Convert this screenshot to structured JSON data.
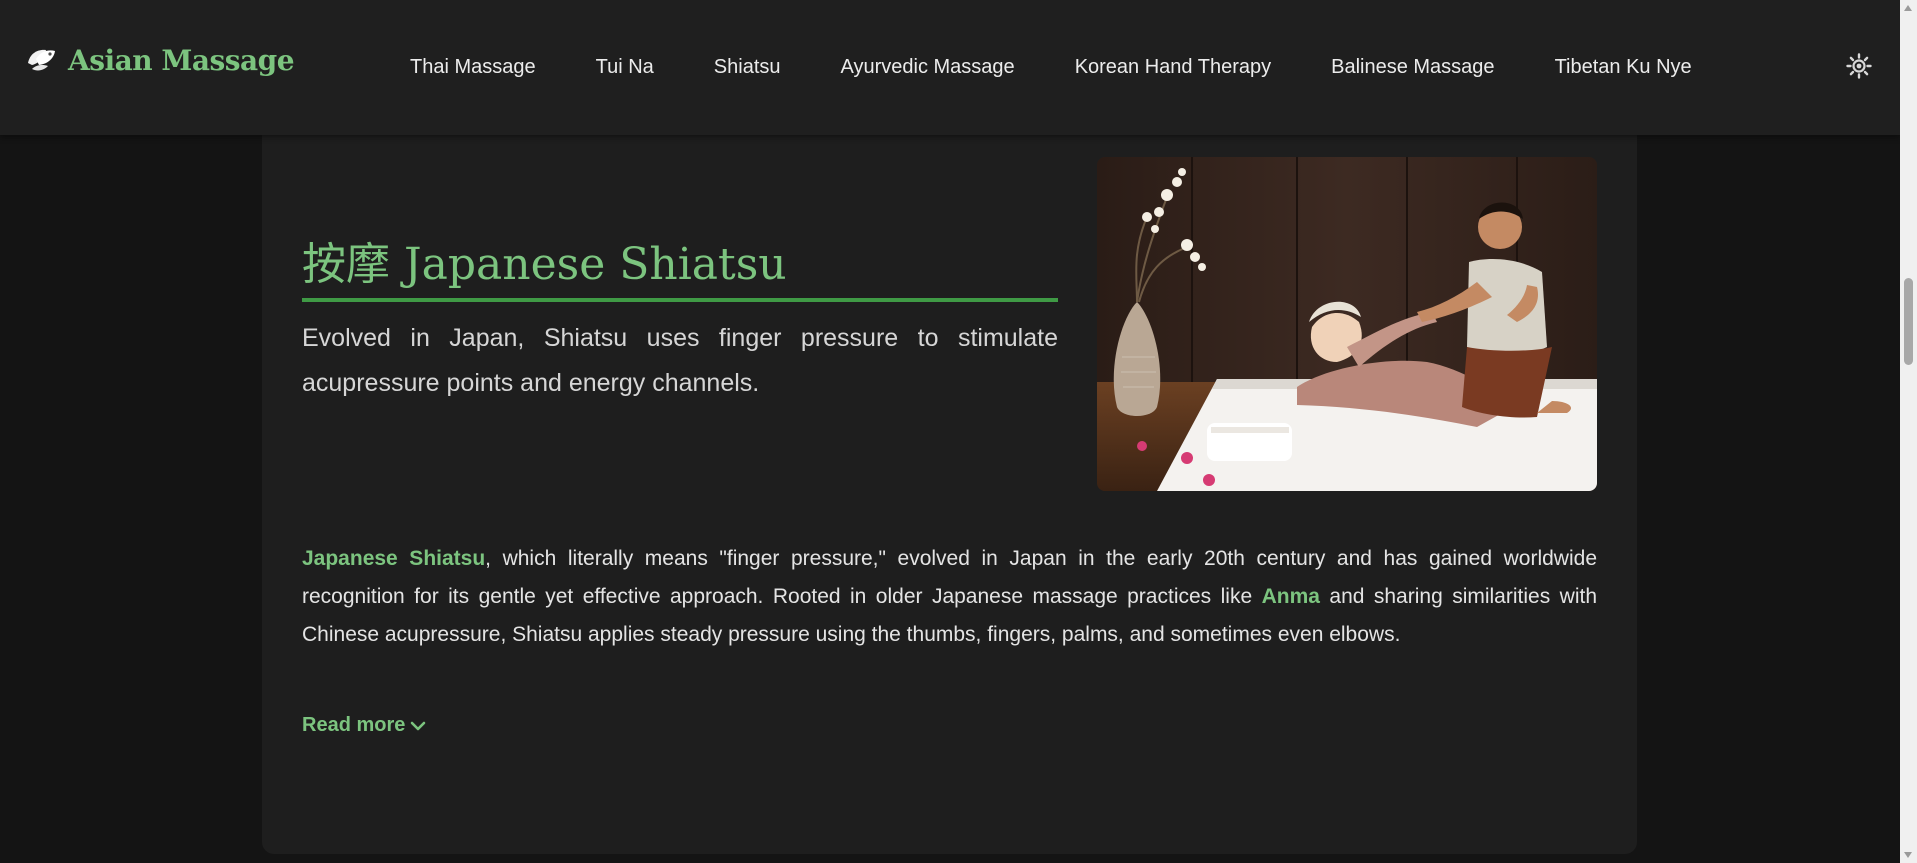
{
  "site": {
    "logo_text": "Asian Massage",
    "logo_icon": "lotus-leaf-icon"
  },
  "nav": {
    "items": [
      {
        "label": "Thai Massage"
      },
      {
        "label": "Tui Na"
      },
      {
        "label": "Shiatsu"
      },
      {
        "label": "Ayurvedic Massage"
      },
      {
        "label": "Korean Hand Therapy"
      },
      {
        "label": "Balinese Massage"
      },
      {
        "label": "Tibetan Ku Nye"
      }
    ],
    "theme_toggle_icon": "sun-icon"
  },
  "hero": {
    "title": "按摩 Japanese Shiatsu",
    "description": "Evolved in Japan, Shiatsu uses finger pressure to stimulate acupressure points and energy channels.",
    "image_alt": "Therapist performing a Shiatsu stretch on a woman lying on a white mat"
  },
  "body": {
    "term": "Japanese Shiatsu",
    "part1": ", which literally means \"finger pressure,\" evolved in Japan in the early 20th century and has gained worldwide recognition for its gentle yet effective approach. Rooted in older Japanese massage practices like ",
    "term2": "Anma",
    "part2": " and sharing similarities with Chinese acupressure, Shiatsu applies steady pressure using the thumbs, fingers, palms, and sometimes even elbows."
  },
  "read_more": {
    "label": "Read more",
    "icon": "chevron-down-icon"
  },
  "colors": {
    "accent": "#7cc47f",
    "accent_rule": "#3f9a45",
    "background": "#141414",
    "header": "#1f1f1f",
    "card": "#1e1e1e"
  }
}
